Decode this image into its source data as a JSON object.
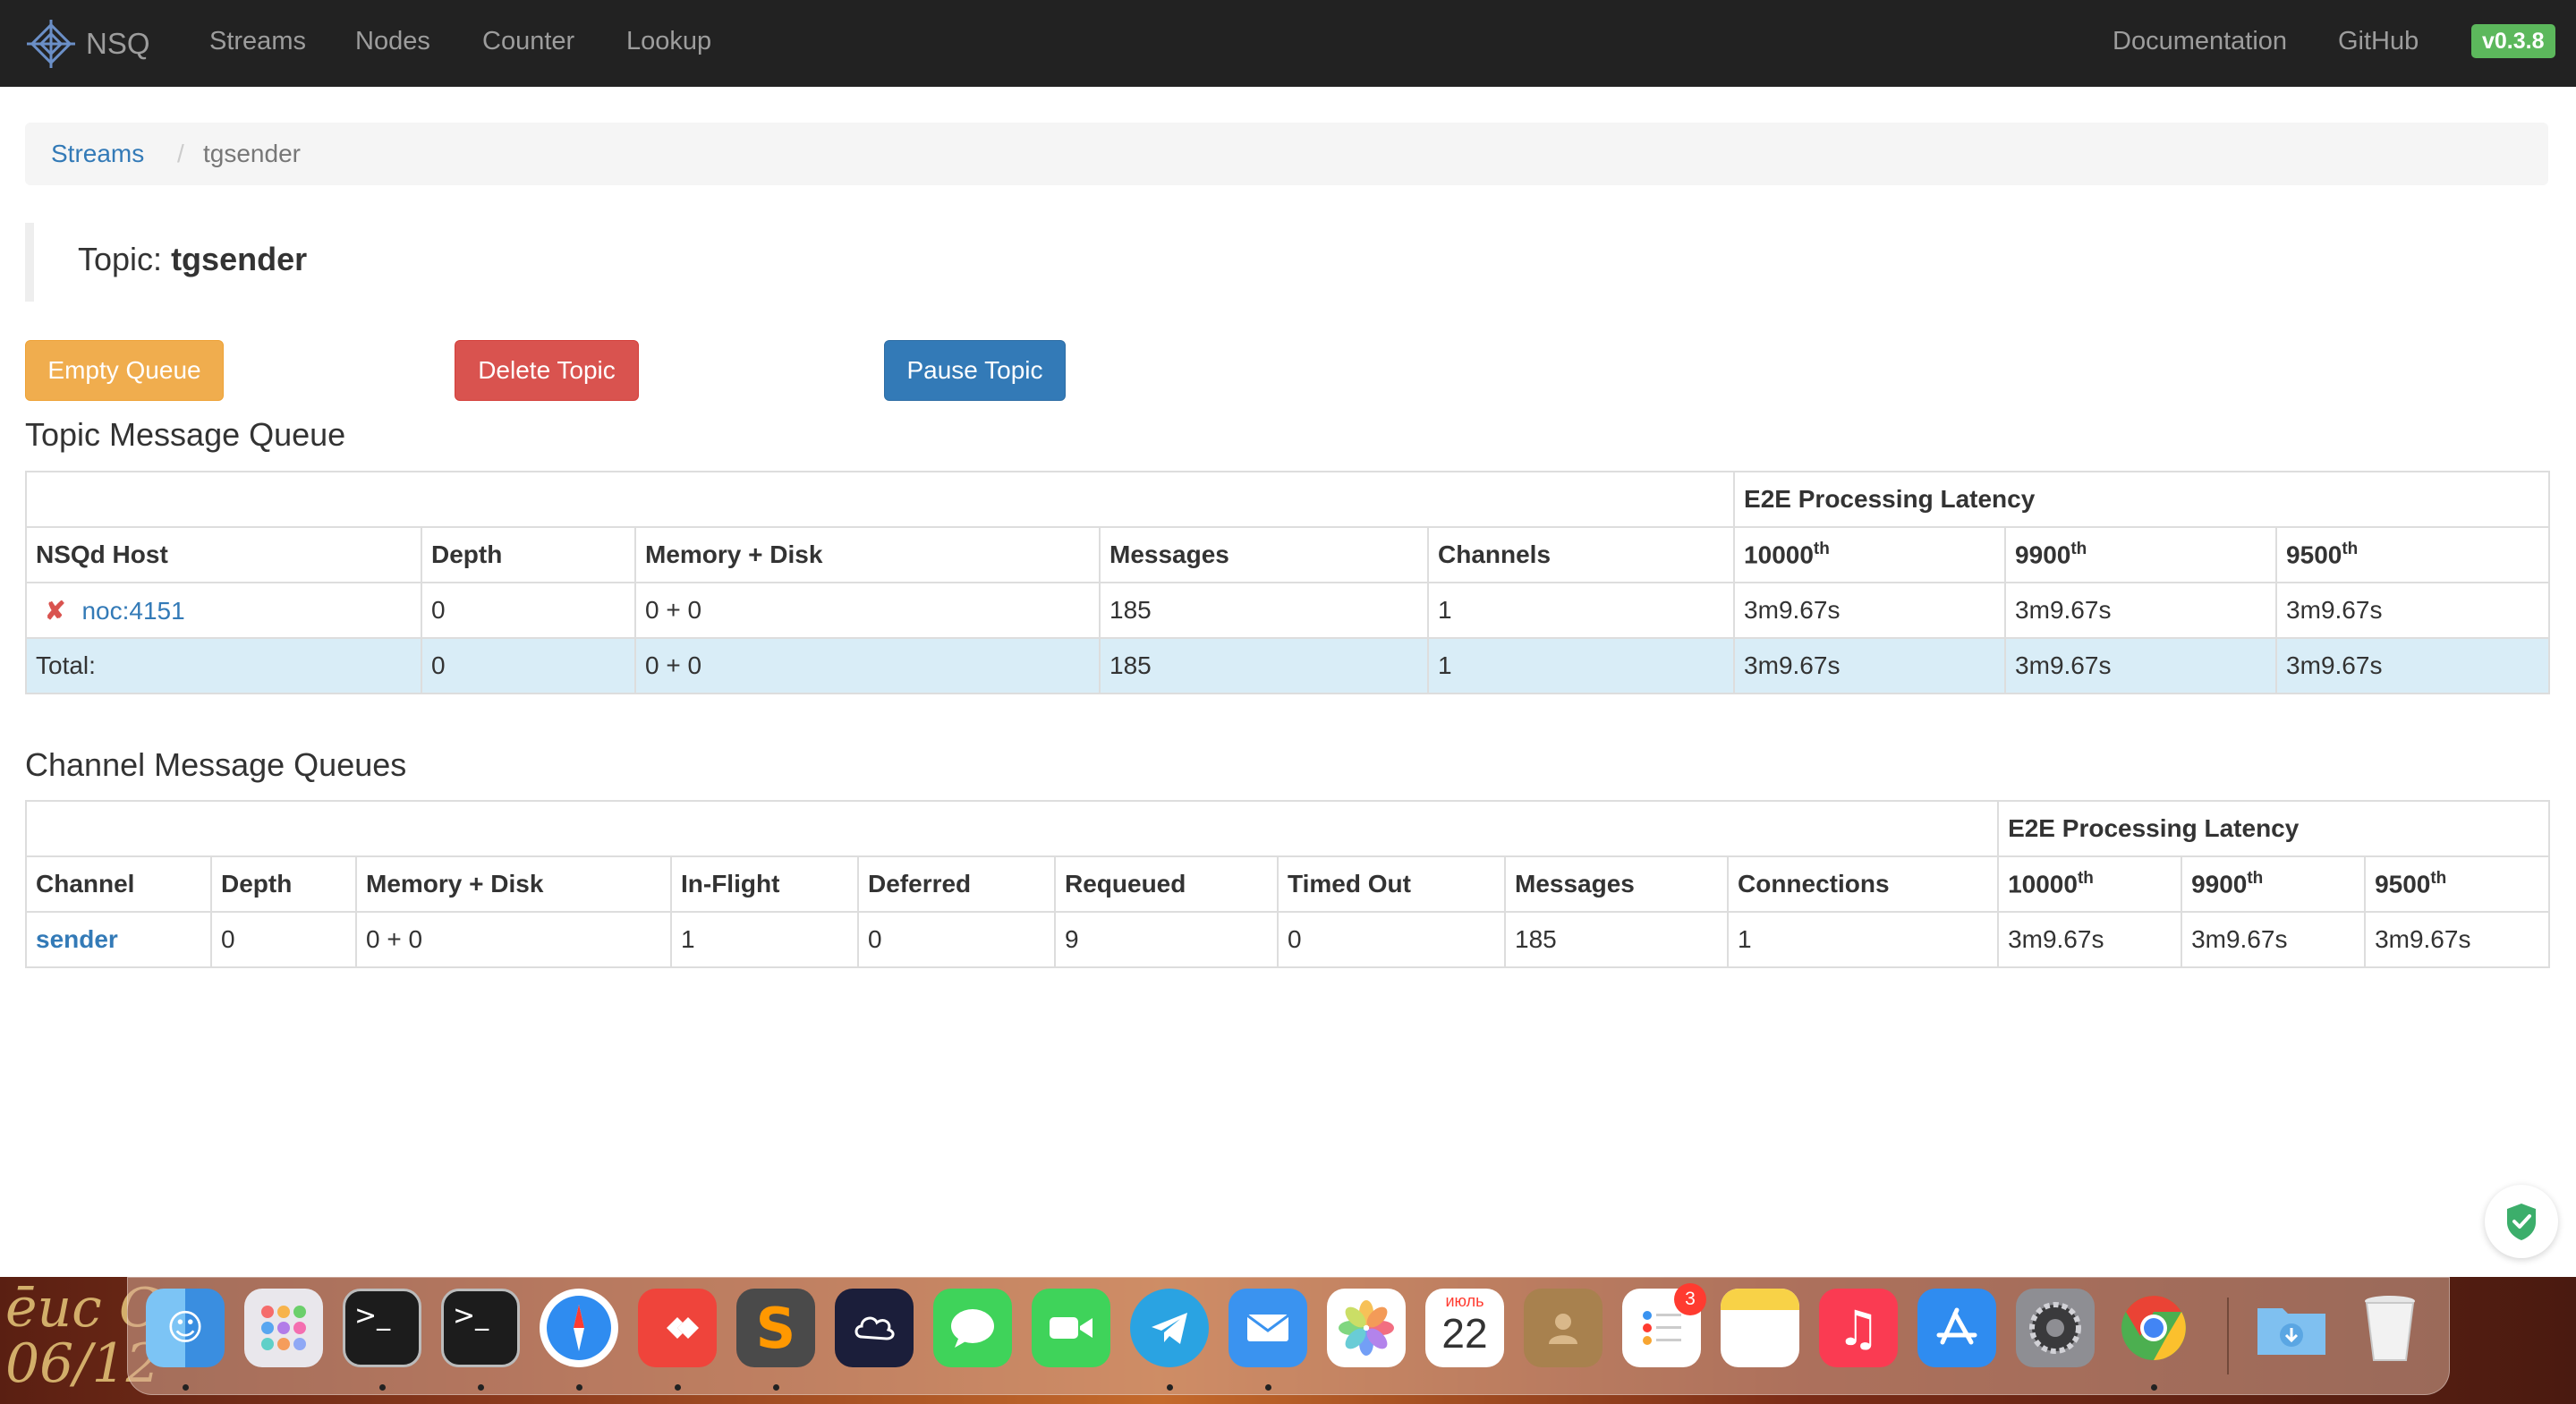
{
  "navbar": {
    "brand": "NSQ",
    "links": [
      "Streams",
      "Nodes",
      "Counter",
      "Lookup"
    ],
    "right_links": [
      "Documentation",
      "GitHub"
    ],
    "version": "v0.3.8"
  },
  "breadcrumb": {
    "link": "Streams",
    "separator": "/",
    "active": "tgsender"
  },
  "topic": {
    "label": "Topic:",
    "name": "tgsender"
  },
  "buttons": {
    "empty_queue": "Empty Queue",
    "delete_topic": "Delete Topic",
    "pause_topic": "Pause Topic"
  },
  "topic_queue": {
    "title": "Topic Message Queue",
    "latency_header": "E2E Processing Latency",
    "headers": [
      "NSQd Host",
      "Depth",
      "Memory + Disk",
      "Messages",
      "Channels"
    ],
    "percentiles": [
      "10000",
      "9900",
      "9500"
    ],
    "ordinal_suffix": "th",
    "row": {
      "status_icon": "✘",
      "host": "noc:4151",
      "depth": "0",
      "memory_disk": "0 + 0",
      "messages": "185",
      "channels": "1",
      "latency": [
        "3m9.67s",
        "3m9.67s",
        "3m9.67s"
      ]
    },
    "total": {
      "label": "Total:",
      "depth": "0",
      "memory_disk": "0 + 0",
      "messages": "185",
      "channels": "1",
      "latency": [
        "3m9.67s",
        "3m9.67s",
        "3m9.67s"
      ]
    }
  },
  "channel_queues": {
    "title": "Channel Message Queues",
    "latency_header": "E2E Processing Latency",
    "headers": [
      "Channel",
      "Depth",
      "Memory + Disk",
      "In-Flight",
      "Deferred",
      "Requeued",
      "Timed Out",
      "Messages",
      "Connections"
    ],
    "percentiles": [
      "10000",
      "9900",
      "9500"
    ],
    "ordinal_suffix": "th",
    "row": {
      "channel": "sender",
      "depth": "0",
      "memory_disk": "0 + 0",
      "in_flight": "1",
      "deferred": "0",
      "requeued": "9",
      "timed_out": "0",
      "messages": "185",
      "connections": "1",
      "latency": [
        "3m9.67s",
        "3m9.67s",
        "3m9.67s"
      ]
    }
  },
  "dock": {
    "calendar_month": "июль",
    "calendar_day": "22",
    "reminders_badge": "3",
    "icons": [
      "finder-icon",
      "launchpad-icon",
      "terminal-icon",
      "terminal-icon",
      "safari-icon",
      "anydesk-icon",
      "sublime-text-icon",
      "cloud-app-icon",
      "messages-icon",
      "facetime-icon",
      "telegram-icon",
      "mail-icon",
      "photos-icon",
      "calendar-icon",
      "contacts-icon",
      "reminders-icon",
      "notes-icon",
      "music-icon",
      "app-store-icon",
      "system-preferences-icon",
      "chrome-icon",
      "downloads-folder-icon",
      "trash-icon"
    ]
  },
  "desktop_text": [
    "ēuc C",
    "06/12"
  ]
}
